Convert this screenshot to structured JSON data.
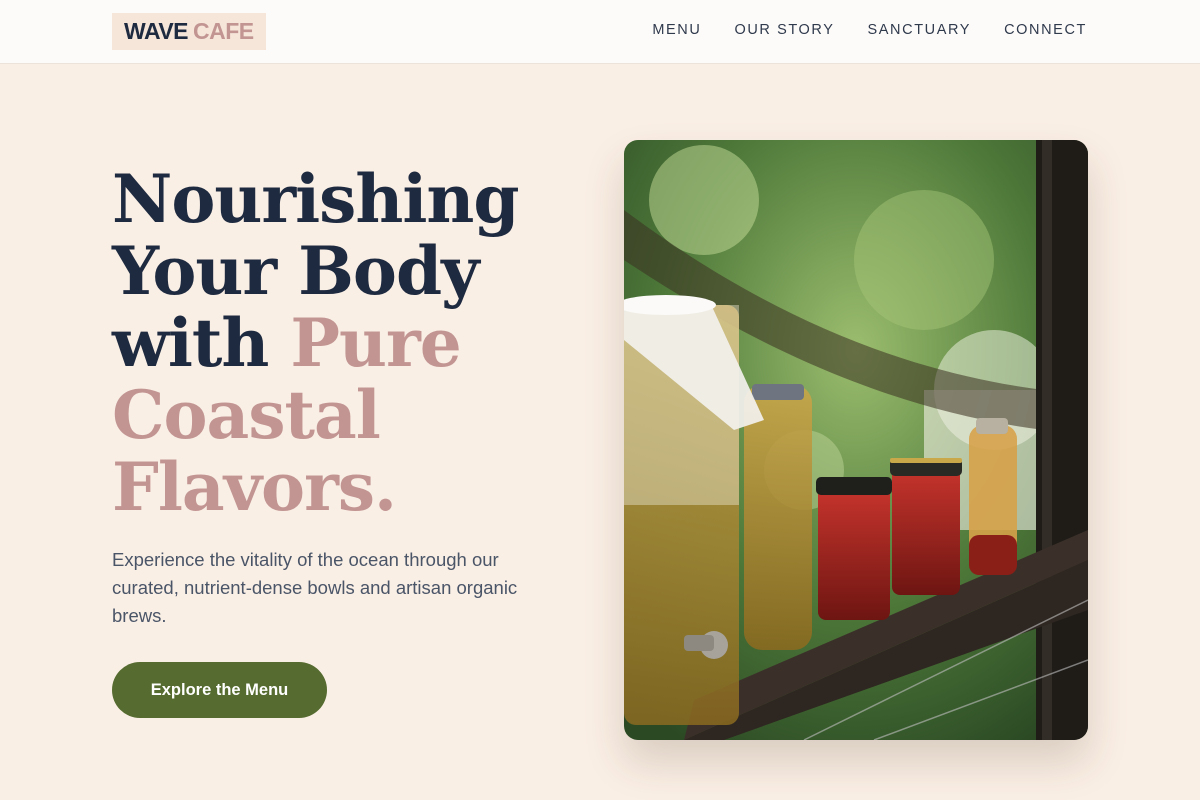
{
  "header": {
    "logo": {
      "part1": "WAVE",
      "part2": "CAFE"
    },
    "nav": [
      {
        "label": "MENU"
      },
      {
        "label": "OUR STORY"
      },
      {
        "label": "SANCTUARY"
      },
      {
        "label": "CONNECT"
      }
    ]
  },
  "hero": {
    "title_lines": [
      {
        "text": "Nourishing"
      },
      {
        "text": "Your Body"
      },
      {
        "text_dark": "with",
        "text_accent": "Pure"
      },
      {
        "text": "Coastal"
      },
      {
        "text": "Flavors."
      }
    ],
    "subtitle": "Experience the vitality of the ocean through our curated, nutrient-dense bowls and artisan organic brews.",
    "cta_label": "Explore the Menu"
  },
  "colors": {
    "background": "#faefe5",
    "navy": "#1e2a40",
    "accent_rose": "#c29592",
    "cta_olive": "#556b2f"
  },
  "image": {
    "alt_subject": "jars-of-fermented-drinks-on-ledge"
  }
}
